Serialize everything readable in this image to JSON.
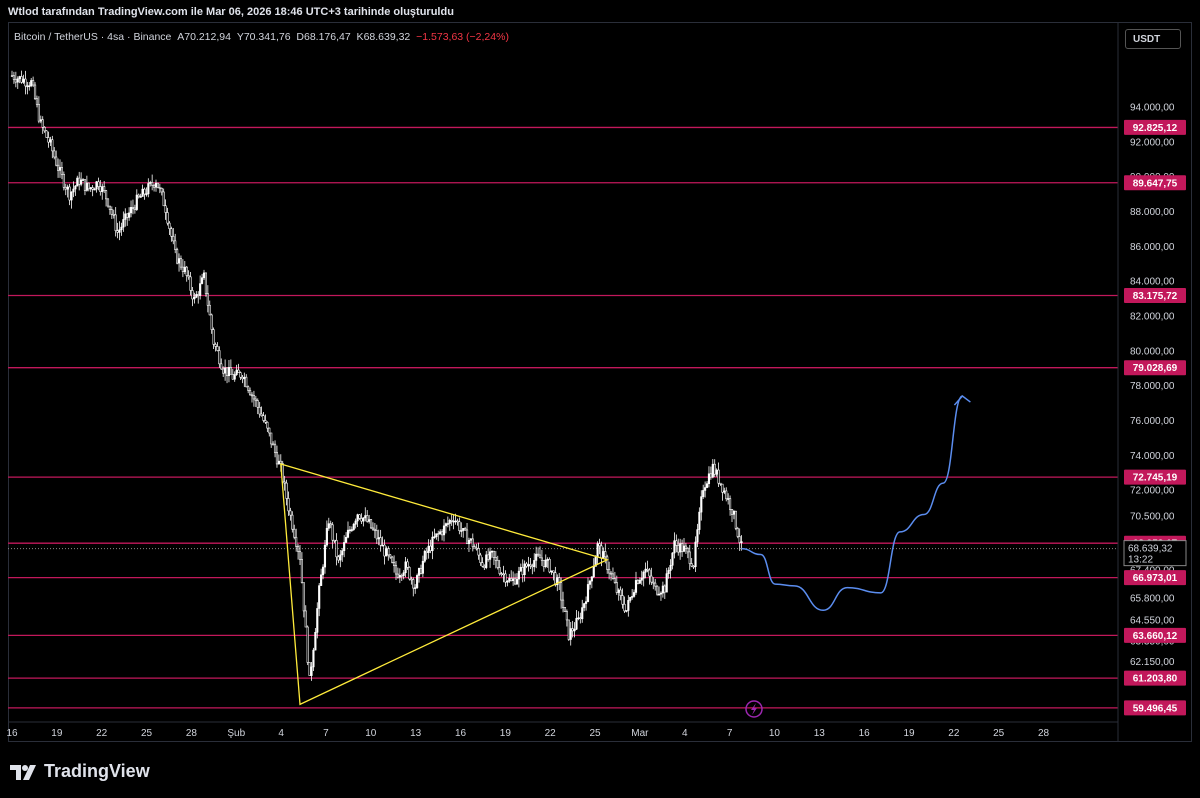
{
  "credit": "Wtlod tarafından TradingView.com ile Mar 06, 2026 18:46 UTC+3 tarihinde oluşturuldu",
  "legend": {
    "symbol": "Bitcoin / TetherUS · 4sa · Binance",
    "open_label": "A",
    "open": "70.212,94",
    "high_label": "Y",
    "high": "70.341,76",
    "low_label": "D",
    "low": "68.176,47",
    "close_label": "K",
    "close": "68.639,32",
    "change": "−1.573,63 (−2,24%)"
  },
  "currency": "USDT",
  "logo_text": "TradingView",
  "colors": {
    "background": "#000000",
    "level_line": "#c2185b",
    "candle_up": "#ffffff",
    "candle_down": "#ffffff",
    "triangle": "#ffeb3b",
    "projection": "#5b8def"
  },
  "chart_data": {
    "type": "candlestick",
    "ylim": [
      58800,
      97500
    ],
    "y_ticks": [
      {
        "value": 94000,
        "label": "94.000,00"
      },
      {
        "value": 92000,
        "label": "92.000,00"
      },
      {
        "value": 90000,
        "label": "90.000,00"
      },
      {
        "value": 88000,
        "label": "88.000,00"
      },
      {
        "value": 86000,
        "label": "86.000,00"
      },
      {
        "value": 84000,
        "label": "84.000,00"
      },
      {
        "value": 82000,
        "label": "82.000,00"
      },
      {
        "value": 80000,
        "label": "80.000,00"
      },
      {
        "value": 78000,
        "label": "78.000,00"
      },
      {
        "value": 76000,
        "label": "76.000,00"
      },
      {
        "value": 74000,
        "label": "74.000,00"
      },
      {
        "value": 72000,
        "label": "72.000,00"
      },
      {
        "value": 70500,
        "label": "70.500,00"
      },
      {
        "value": 67400,
        "label": "67.400,00"
      },
      {
        "value": 65800,
        "label": "65.800,00"
      },
      {
        "value": 64550,
        "label": "64.550,00"
      },
      {
        "value": 63350,
        "label": "63.350,00"
      },
      {
        "value": 62150,
        "label": "62.150,00"
      }
    ],
    "x_ticks": [
      "16",
      "19",
      "22",
      "25",
      "28",
      "Şub",
      "4",
      "7",
      "10",
      "13",
      "16",
      "19",
      "22",
      "25",
      "Mar",
      "4",
      "7",
      "10",
      "13",
      "16",
      "19",
      "22",
      "25",
      "28"
    ],
    "horizontal_levels": [
      {
        "value": 92825.12,
        "label": "92.825,12"
      },
      {
        "value": 89647.75,
        "label": "89.647,75"
      },
      {
        "value": 83175.72,
        "label": "83.175,72"
      },
      {
        "value": 79028.69,
        "label": "79.028,69"
      },
      {
        "value": 72745.19,
        "label": "72.745,19"
      },
      {
        "value": 68952.17,
        "label": "68.952,17"
      },
      {
        "value": 66973.01,
        "label": "66.973,01"
      },
      {
        "value": 63660.12,
        "label": "63.660,12"
      },
      {
        "value": 61203.8,
        "label": "61.203,80"
      },
      {
        "value": 59496.45,
        "label": "59.496,45"
      }
    ],
    "current_price": {
      "value": 68639.32,
      "label": "68.639,32",
      "countdown": "13:22"
    },
    "price_path": [
      [
        0,
        95800
      ],
      [
        2,
        95400
      ],
      [
        3,
        93000
      ],
      [
        4,
        91800
      ],
      [
        5,
        90200
      ],
      [
        6,
        89000
      ],
      [
        7,
        89800
      ],
      [
        8,
        89300
      ],
      [
        9,
        89700
      ],
      [
        10,
        88600
      ],
      [
        11,
        86800
      ],
      [
        12,
        87700
      ],
      [
        13,
        88600
      ],
      [
        14,
        89200
      ],
      [
        15,
        89800
      ],
      [
        16,
        88200
      ],
      [
        17,
        85500
      ],
      [
        18,
        84600
      ],
      [
        19,
        82900
      ],
      [
        20,
        84200
      ],
      [
        21,
        80500
      ],
      [
        22,
        79000
      ],
      [
        23,
        78500
      ],
      [
        24,
        78700
      ],
      [
        25,
        77500
      ],
      [
        26,
        76300
      ],
      [
        27,
        74800
      ],
      [
        28,
        73200
      ],
      [
        29,
        70500
      ],
      [
        30,
        68200
      ],
      [
        31,
        61000
      ],
      [
        32,
        66200
      ],
      [
        33,
        70300
      ],
      [
        34,
        67800
      ],
      [
        35,
        69500
      ],
      [
        36,
        70700
      ],
      [
        37,
        70200
      ],
      [
        38,
        69300
      ],
      [
        39,
        68300
      ],
      [
        40,
        67200
      ],
      [
        41,
        67600
      ],
      [
        42,
        66500
      ],
      [
        43,
        68200
      ],
      [
        44,
        69200
      ],
      [
        45,
        69800
      ],
      [
        46,
        70500
      ],
      [
        47,
        69500
      ],
      [
        48,
        68900
      ],
      [
        49,
        67800
      ],
      [
        50,
        68200
      ],
      [
        51,
        67300
      ],
      [
        52,
        66700
      ],
      [
        53,
        67300
      ],
      [
        54,
        67900
      ],
      [
        55,
        68100
      ],
      [
        56,
        67600
      ],
      [
        57,
        66400
      ],
      [
        58,
        63700
      ],
      [
        59,
        64500
      ],
      [
        60,
        66300
      ],
      [
        61,
        68800
      ],
      [
        62,
        67700
      ],
      [
        63,
        66200
      ],
      [
        64,
        65100
      ],
      [
        65,
        66800
      ],
      [
        66,
        67400
      ],
      [
        67,
        66300
      ],
      [
        68,
        66400
      ],
      [
        69,
        68900
      ],
      [
        70,
        68600
      ],
      [
        71,
        67800
      ],
      [
        72,
        72200
      ],
      [
        73,
        73300
      ],
      [
        74,
        72200
      ],
      [
        75,
        70900
      ],
      [
        76,
        68700
      ]
    ],
    "path_x_end_index": 76,
    "triangle": [
      [
        28,
        73500
      ],
      [
        62,
        68000
      ],
      [
        30,
        59700
      ]
    ],
    "projection_path": [
      [
        76,
        68639
      ],
      [
        78,
        68300
      ],
      [
        79.5,
        66600
      ],
      [
        81.5,
        66500
      ],
      [
        84.5,
        65100
      ],
      [
        87,
        66400
      ],
      [
        90.5,
        66100
      ],
      [
        92.5,
        69600
      ],
      [
        95,
        70600
      ],
      [
        97,
        72400
      ],
      [
        99,
        77400
      ]
    ]
  }
}
